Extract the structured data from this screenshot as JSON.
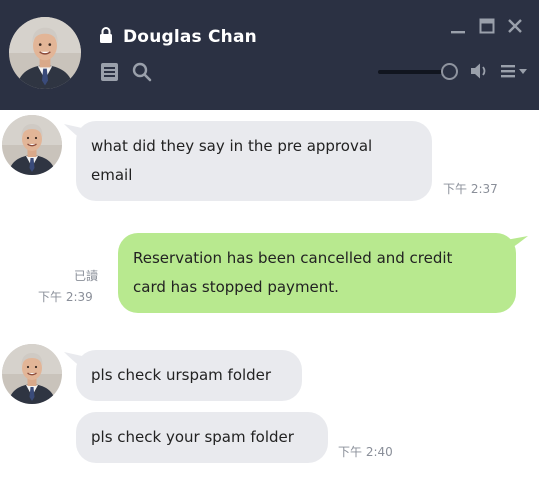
{
  "header": {
    "contact_name": "Douglas Chan",
    "icons": {
      "lock": "lock-icon",
      "notes": "notes-icon",
      "search": "search-icon",
      "volume": "volume-icon",
      "menu": "menu-icon",
      "minimize": "minimize-icon",
      "maximize": "maximize-icon",
      "close": "close-icon"
    },
    "volume_level": 0.85
  },
  "colors": {
    "header_bg": "#2b3143",
    "incoming_bubble": "#e9eaee",
    "outgoing_bubble": "#b8e98f",
    "timestamp": "#8a8f99"
  },
  "messages": [
    {
      "direction": "in",
      "line1": "what did they say in the pre approval",
      "line2": "email",
      "time": "下午 2:37"
    },
    {
      "direction": "out",
      "line1": "Reservation has been cancelled and credit",
      "line2": "card has stopped payment.",
      "read": "已讀",
      "time": "下午 2:39"
    },
    {
      "direction": "in",
      "text": "pls check urspam folder"
    },
    {
      "direction": "in",
      "text": "pls check your spam folder",
      "time": "下午 2:40"
    }
  ]
}
